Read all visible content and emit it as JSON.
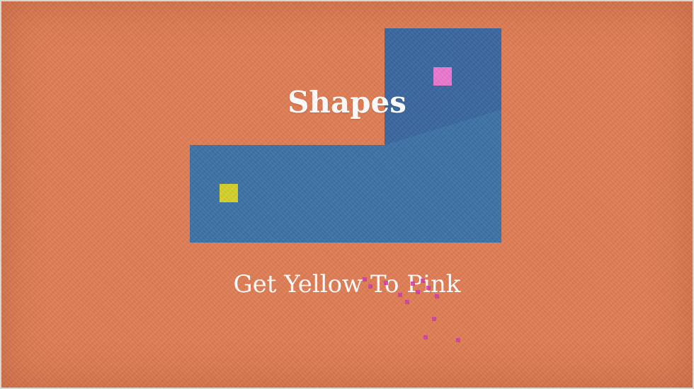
{
  "game": {
    "title": "Shapes",
    "subtitle": "Get Yellow To Pink"
  },
  "colors": {
    "background": "#e07e55",
    "shape_fill": "#3d73a6",
    "shape_shadow": "#3a67a0",
    "player": "#d4d12c",
    "goal": "#ea78cf",
    "particles": "#d03aa9"
  },
  "icons": {
    "player": "yellow-square",
    "goal": "pink-square"
  }
}
